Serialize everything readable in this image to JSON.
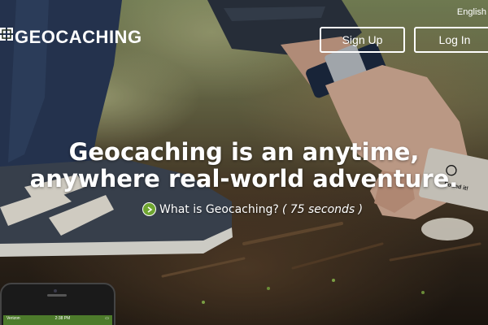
{
  "header": {
    "logo_text": "GEOCACHING",
    "language": "English",
    "signup_label": "Sign Up",
    "login_label": "Log In"
  },
  "hero": {
    "headline": "Geocaching is an anytime, anywhere real-world adventure.",
    "video_link_text": "What is Geocaching?",
    "video_duration": "( 75 seconds )"
  },
  "geocache_card": {
    "label": "Found it!"
  },
  "phone": {
    "carrier": "Verizon",
    "time": "2:38 PM"
  },
  "colors": {
    "play_button": "#6fa531",
    "overlay_text": "#ffffff"
  }
}
